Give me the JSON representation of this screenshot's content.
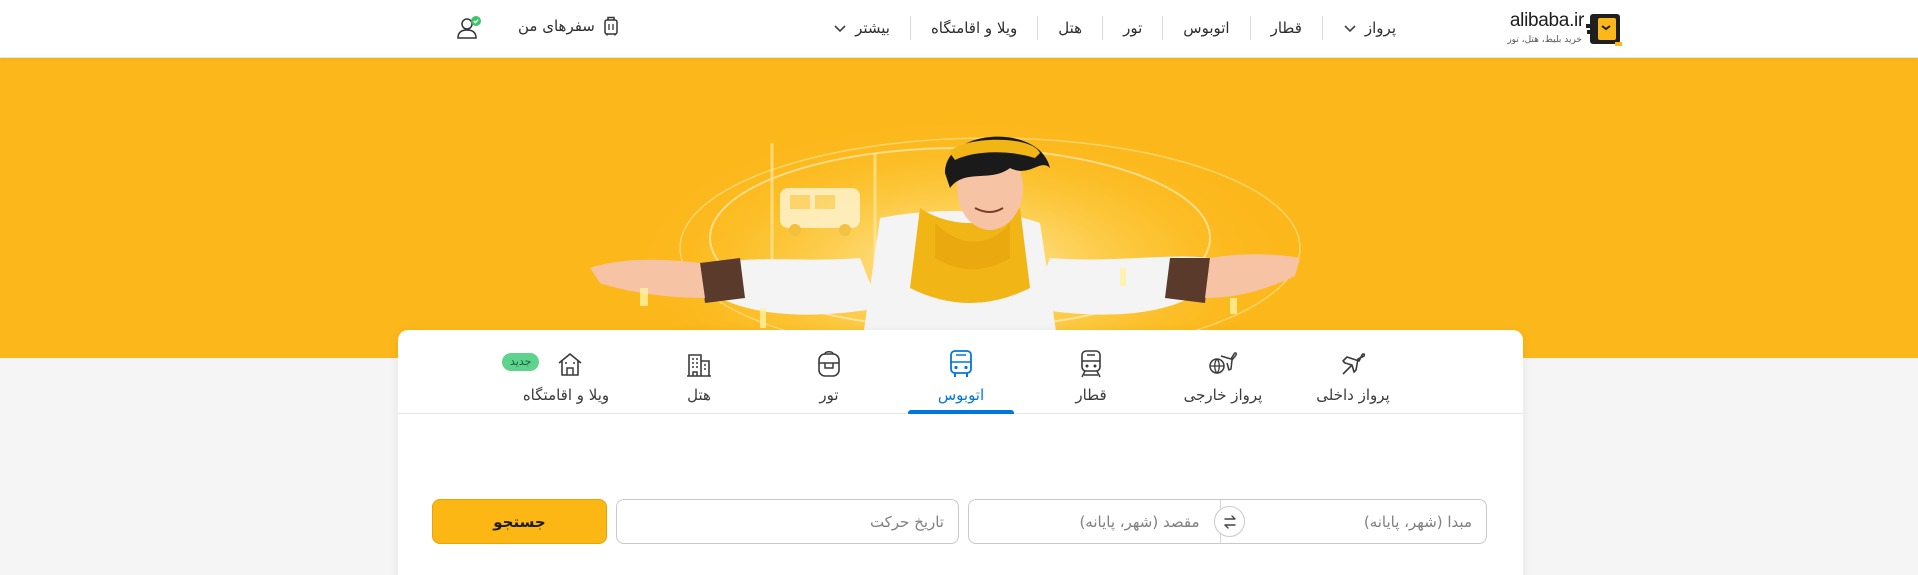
{
  "header": {
    "logo": {
      "name": "alibaba.ir",
      "tagline": "خرید بلیط، هتل، تور"
    },
    "nav": [
      {
        "label": "پرواز",
        "has_dropdown": true
      },
      {
        "label": "قطار"
      },
      {
        "label": "اتوبوس"
      },
      {
        "label": "تور"
      },
      {
        "label": "هتل"
      },
      {
        "label": "ویلا و اقامتگاه"
      },
      {
        "label": "بیشتر",
        "has_dropdown": true
      }
    ],
    "my_trips": "سفرهای من",
    "user_status_color": "#3ec46d"
  },
  "colors": {
    "brand_yellow": "#fcb81b",
    "accent_blue": "#0077db",
    "search_button": "#fdb714",
    "new_badge": "#5fd38d"
  },
  "tabs": [
    {
      "label": "پرواز داخلی",
      "icon": "airplane-icon"
    },
    {
      "label": "پرواز خارجی",
      "icon": "airplane-globe-icon"
    },
    {
      "label": "قطار",
      "icon": "train-icon"
    },
    {
      "label": "اتوبوس",
      "icon": "bus-icon",
      "active": true
    },
    {
      "label": "تور",
      "icon": "backpack-icon"
    },
    {
      "label": "هتل",
      "icon": "hotel-icon"
    },
    {
      "label": "ویلا و اقامتگاه",
      "icon": "villa-icon",
      "badge": "جدید"
    }
  ],
  "search": {
    "origin_placeholder": "مبدا (شهر، پایانه)",
    "destination_placeholder": "مقصد (شهر، پایانه)",
    "date_placeholder": "تاریخ حرکت",
    "button_label": "جستجو"
  }
}
